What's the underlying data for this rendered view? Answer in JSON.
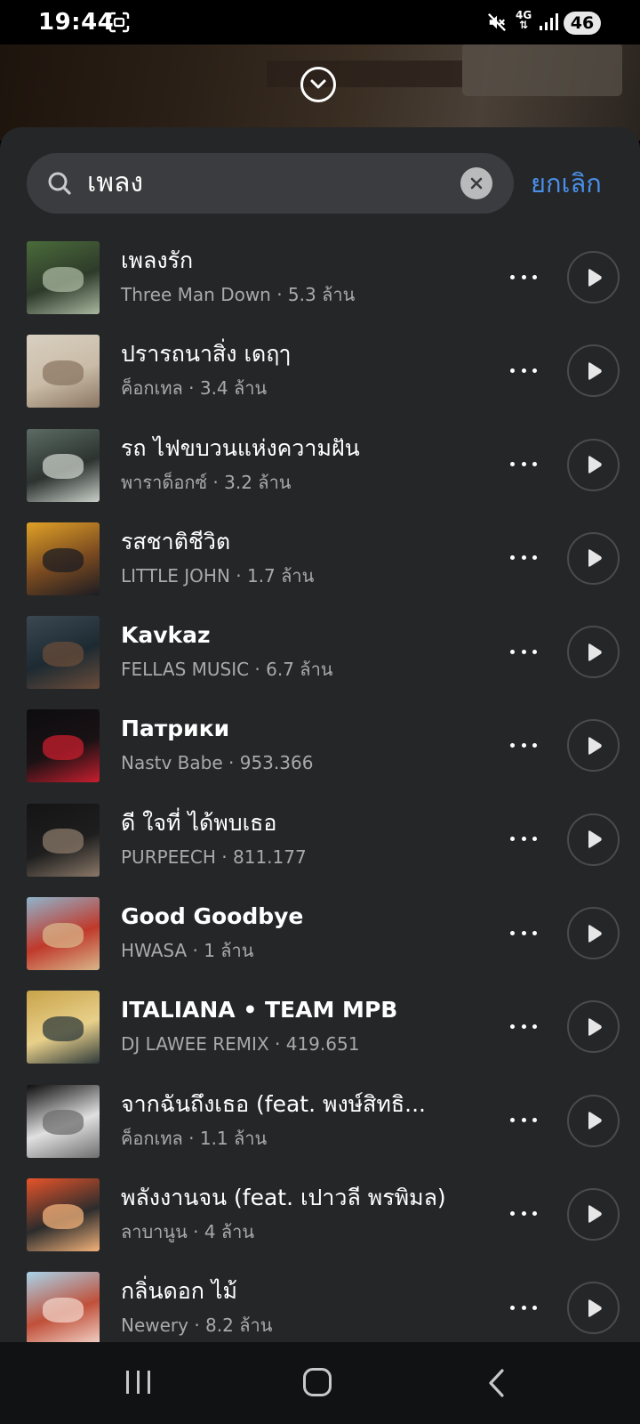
{
  "status_bar": {
    "time": "19:44",
    "network": "4G",
    "battery": "46"
  },
  "search": {
    "query": "เพลง",
    "cancel_label": "ยกเลิก"
  },
  "songs": [
    {
      "title": "เพลงรัก",
      "subtitle": "Three Man Down · 5.3 ล้าน",
      "bold": false,
      "art": [
        "#4a6b3a",
        "#a9b8a0",
        "#2e3a2a"
      ]
    },
    {
      "title": "ปรารถนาสิ่ง เดฤๅ",
      "subtitle": "ค็อกเทล · 3.4 ล้าน",
      "bold": false,
      "art": [
        "#d9d0c2",
        "#8b7763",
        "#c9bba6"
      ]
    },
    {
      "title": "รถ ไฟขบวนแห่งความฝัน",
      "subtitle": "พาราด็อกซ์ · 3.2 ล้าน",
      "bold": false,
      "art": [
        "#5c6b63",
        "#c9cfc8",
        "#2c3330"
      ]
    },
    {
      "title": "รสชาติชีวิต",
      "subtitle": "LITTLE JOHN · 1.7 ล้าน",
      "bold": false,
      "art": [
        "#e0a126",
        "#1c1c22",
        "#7a4a20"
      ]
    },
    {
      "title": "Kavkaz",
      "subtitle": "FELLAS MUSIC · 6.7 ล้าน",
      "bold": true,
      "art": [
        "#3a4852",
        "#6a4c3a",
        "#1d2a32"
      ]
    },
    {
      "title": "Патрики",
      "subtitle": "Nastv Babe · 953.366",
      "bold": true,
      "art": [
        "#0c0c0f",
        "#c81e2e",
        "#1a1214"
      ]
    },
    {
      "title": "ดี ใจที่ ได้พบเธอ",
      "subtitle": "PURPEECH · 811.177",
      "bold": false,
      "art": [
        "#141414",
        "#8a7868",
        "#1e1e1e"
      ]
    },
    {
      "title": "Good Goodbye",
      "subtitle": "HWASA · 1 ล้าน",
      "bold": true,
      "art": [
        "#8fb4cc",
        "#d8b68a",
        "#c0392b"
      ]
    },
    {
      "title": "ITALIANA • TEAM MPB",
      "subtitle": "DJ LAWEE REMIX · 419.651",
      "bold": true,
      "art": [
        "#c9a34a",
        "#2f3a3a",
        "#e8d08a"
      ]
    },
    {
      "title": "จากฉันถึงเธอ (feat. พงษ์สิทธิ...",
      "subtitle": "ค็อกเทล · 1.1 ล้าน",
      "bold": false,
      "art": [
        "#0d0d0d",
        "#6e6e6e",
        "#e0e0e0"
      ]
    },
    {
      "title": "พลังงานจน (feat. เปาวลี พรพิมล)",
      "subtitle": "ลาบานูน · 4 ล้าน",
      "bold": false,
      "art": [
        "#e8542a",
        "#f3b27a",
        "#2c2c2c"
      ]
    },
    {
      "title": "กลิ่นดอก ไม้",
      "subtitle": "Newery · 8.2 ล้าน",
      "bold": false,
      "art": [
        "#a8d4ea",
        "#f2d3c8",
        "#c0503a"
      ]
    }
  ]
}
